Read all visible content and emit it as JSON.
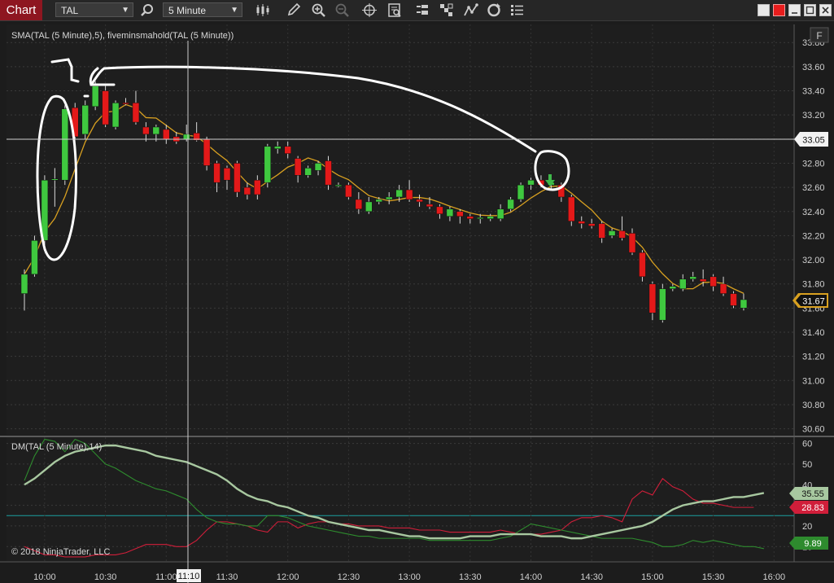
{
  "toolbar": {
    "title": "Chart",
    "instrument": "TAL",
    "interval": "5 Minute"
  },
  "price_panel": {
    "legend": "SMA(TAL (5 Minute),5), fiveminsmahold(TAL (5 Minute))",
    "y_ticks": [
      "33.80",
      "33.60",
      "33.40",
      "33.20",
      "33.00",
      "32.80",
      "32.60",
      "32.40",
      "32.20",
      "32.00",
      "31.80",
      "31.60",
      "31.40",
      "31.20",
      "31.00",
      "30.80",
      "30.60"
    ],
    "crosshair_price": "33.05",
    "last_price": "31.67",
    "f_button": "F"
  },
  "dm_panel": {
    "legend": "DM(TAL (5 Minute),14)",
    "y_ticks": [
      "60",
      "50",
      "40",
      "30",
      "20",
      "10"
    ],
    "adx_value": "35.55",
    "minus_di_value": "28.83",
    "plus_di_value": "9.89",
    "copyright": "© 2018 NinjaTrader, LLC"
  },
  "time_axis": {
    "labels": [
      "10:00",
      "10:30",
      "11:00",
      "11:30",
      "12:00",
      "12:30",
      "13:00",
      "13:30",
      "14:00",
      "14:30",
      "15:00",
      "15:30",
      "16:00"
    ],
    "crosshair_time": "11:10"
  },
  "colors": {
    "up_candle": "#3fc83f",
    "down_candle": "#e31919",
    "sma": "#d8a020",
    "adx": "#a8c8a0",
    "plus_di": "#2e8b2e",
    "minus_di": "#d01e3a",
    "title_bar": "#8e1620"
  },
  "icons": [
    "search-icon",
    "bar-style-icon",
    "pencil-icon",
    "zoom-in-icon",
    "zoom-out-icon",
    "crosshair-icon",
    "properties-icon",
    "data-box-icon",
    "strategy-icon",
    "indicator-icon",
    "refresh-icon",
    "list-icon"
  ],
  "chart_data": {
    "type": "candlestick",
    "candles": [
      {
        "o": 31.72,
        "h": 31.92,
        "l": 31.58,
        "c": 31.88
      },
      {
        "o": 31.88,
        "h": 32.2,
        "l": 31.86,
        "c": 32.16
      },
      {
        "o": 32.16,
        "h": 32.7,
        "l": 32.12,
        "c": 32.66
      },
      {
        "o": 32.66,
        "h": 32.76,
        "l": 32.44,
        "c": 32.67
      },
      {
        "o": 32.66,
        "h": 33.28,
        "l": 32.62,
        "c": 33.25
      },
      {
        "o": 33.26,
        "h": 33.3,
        "l": 33.0,
        "c": 33.02
      },
      {
        "o": 33.04,
        "h": 33.32,
        "l": 33.0,
        "c": 33.28
      },
      {
        "o": 33.27,
        "h": 33.48,
        "l": 33.24,
        "c": 33.44
      },
      {
        "o": 33.4,
        "h": 33.44,
        "l": 33.1,
        "c": 33.12
      },
      {
        "o": 33.1,
        "h": 33.32,
        "l": 33.08,
        "c": 33.3
      },
      {
        "o": 33.3,
        "h": 33.34,
        "l": 33.28,
        "c": 33.29
      },
      {
        "o": 33.3,
        "h": 33.4,
        "l": 33.12,
        "c": 33.14
      },
      {
        "o": 33.1,
        "h": 33.14,
        "l": 32.98,
        "c": 33.04
      },
      {
        "o": 33.04,
        "h": 33.12,
        "l": 32.98,
        "c": 33.1
      },
      {
        "o": 33.08,
        "h": 33.12,
        "l": 32.96,
        "c": 33.0
      },
      {
        "o": 33.02,
        "h": 33.06,
        "l": 32.96,
        "c": 32.98
      },
      {
        "o": 33.0,
        "h": 33.12,
        "l": 32.98,
        "c": 33.04
      },
      {
        "o": 33.05,
        "h": 33.14,
        "l": 32.98,
        "c": 32.99
      },
      {
        "o": 33.0,
        "h": 33.02,
        "l": 32.74,
        "c": 32.78
      },
      {
        "o": 32.8,
        "h": 32.82,
        "l": 32.56,
        "c": 32.64
      },
      {
        "o": 32.76,
        "h": 32.78,
        "l": 32.58,
        "c": 32.66
      },
      {
        "o": 32.8,
        "h": 32.82,
        "l": 32.52,
        "c": 32.56
      },
      {
        "o": 32.6,
        "h": 32.64,
        "l": 32.5,
        "c": 32.54
      },
      {
        "o": 32.66,
        "h": 32.7,
        "l": 32.5,
        "c": 32.54
      },
      {
        "o": 32.64,
        "h": 32.96,
        "l": 32.6,
        "c": 32.94
      },
      {
        "o": 32.92,
        "h": 32.98,
        "l": 32.88,
        "c": 32.94
      },
      {
        "o": 32.94,
        "h": 32.98,
        "l": 32.84,
        "c": 32.88
      },
      {
        "o": 32.84,
        "h": 32.86,
        "l": 32.64,
        "c": 32.7
      },
      {
        "o": 32.7,
        "h": 32.78,
        "l": 32.68,
        "c": 32.76
      },
      {
        "o": 32.74,
        "h": 32.82,
        "l": 32.7,
        "c": 32.8
      },
      {
        "o": 32.82,
        "h": 32.86,
        "l": 32.58,
        "c": 32.62
      },
      {
        "o": 32.62,
        "h": 32.64,
        "l": 32.6,
        "c": 32.62
      },
      {
        "o": 32.62,
        "h": 32.64,
        "l": 32.5,
        "c": 32.52
      },
      {
        "o": 32.5,
        "h": 32.56,
        "l": 32.38,
        "c": 32.42
      },
      {
        "o": 32.4,
        "h": 32.52,
        "l": 32.38,
        "c": 32.48
      },
      {
        "o": 32.48,
        "h": 32.52,
        "l": 32.46,
        "c": 32.5
      },
      {
        "o": 32.5,
        "h": 32.56,
        "l": 32.46,
        "c": 32.52
      },
      {
        "o": 32.52,
        "h": 32.62,
        "l": 32.48,
        "c": 32.58
      },
      {
        "o": 32.58,
        "h": 32.66,
        "l": 32.48,
        "c": 32.5
      },
      {
        "o": 32.5,
        "h": 32.54,
        "l": 32.44,
        "c": 32.48
      },
      {
        "o": 32.46,
        "h": 32.52,
        "l": 32.42,
        "c": 32.44
      },
      {
        "o": 32.44,
        "h": 32.46,
        "l": 32.34,
        "c": 32.38
      },
      {
        "o": 32.36,
        "h": 32.44,
        "l": 32.32,
        "c": 32.42
      },
      {
        "o": 32.4,
        "h": 32.42,
        "l": 32.3,
        "c": 32.36
      },
      {
        "o": 32.36,
        "h": 32.38,
        "l": 32.3,
        "c": 32.34
      },
      {
        "o": 32.34,
        "h": 32.38,
        "l": 32.3,
        "c": 32.35
      },
      {
        "o": 32.34,
        "h": 32.38,
        "l": 32.32,
        "c": 32.36
      },
      {
        "o": 32.34,
        "h": 32.46,
        "l": 32.32,
        "c": 32.42
      },
      {
        "o": 32.42,
        "h": 32.52,
        "l": 32.4,
        "c": 32.5
      },
      {
        "o": 32.5,
        "h": 32.64,
        "l": 32.48,
        "c": 32.62
      },
      {
        "o": 32.62,
        "h": 32.68,
        "l": 32.58,
        "c": 32.66
      },
      {
        "o": 32.66,
        "h": 32.7,
        "l": 32.6,
        "c": 32.62
      },
      {
        "o": 32.62,
        "h": 32.68,
        "l": 32.58,
        "c": 32.64
      },
      {
        "o": 32.62,
        "h": 32.64,
        "l": 32.48,
        "c": 32.52
      },
      {
        "o": 32.52,
        "h": 32.54,
        "l": 32.28,
        "c": 32.32
      },
      {
        "o": 32.32,
        "h": 32.36,
        "l": 32.26,
        "c": 32.3
      },
      {
        "o": 32.3,
        "h": 32.34,
        "l": 32.26,
        "c": 32.28
      },
      {
        "o": 32.3,
        "h": 32.32,
        "l": 32.14,
        "c": 32.18
      },
      {
        "o": 32.2,
        "h": 32.26,
        "l": 32.18,
        "c": 32.24
      },
      {
        "o": 32.24,
        "h": 32.36,
        "l": 32.16,
        "c": 32.18
      },
      {
        "o": 32.22,
        "h": 32.26,
        "l": 32.04,
        "c": 32.06
      },
      {
        "o": 32.06,
        "h": 32.08,
        "l": 31.82,
        "c": 31.86
      },
      {
        "o": 31.8,
        "h": 31.82,
        "l": 31.5,
        "c": 31.56
      },
      {
        "o": 31.5,
        "h": 31.8,
        "l": 31.48,
        "c": 31.76
      },
      {
        "o": 31.76,
        "h": 31.8,
        "l": 31.74,
        "c": 31.78
      },
      {
        "o": 31.76,
        "h": 31.88,
        "l": 31.74,
        "c": 31.84
      },
      {
        "o": 31.84,
        "h": 31.9,
        "l": 31.82,
        "c": 31.86
      },
      {
        "o": 31.84,
        "h": 31.92,
        "l": 31.78,
        "c": 31.82
      },
      {
        "o": 31.86,
        "h": 31.88,
        "l": 31.74,
        "c": 31.78
      },
      {
        "o": 31.8,
        "h": 31.86,
        "l": 31.7,
        "c": 31.72
      },
      {
        "o": 31.72,
        "h": 31.74,
        "l": 31.6,
        "c": 31.62
      },
      {
        "o": 31.6,
        "h": 31.72,
        "l": 31.58,
        "c": 31.67
      }
    ],
    "y_range": [
      30.55,
      33.95
    ],
    "dm_range": [
      3,
      63
    ],
    "dm_reference_level": 25,
    "adx": [
      40,
      43,
      47,
      51,
      54,
      56,
      57,
      58,
      59,
      59,
      58,
      57,
      56,
      54,
      53,
      52,
      51,
      49,
      47,
      45,
      42,
      38,
      35,
      33,
      32,
      30,
      29,
      27,
      25,
      24,
      22,
      21,
      20,
      19,
      18,
      18,
      17,
      16,
      15,
      15,
      14,
      14,
      14,
      14,
      15,
      15,
      15,
      16,
      16,
      16,
      16,
      15,
      15,
      15,
      14,
      14,
      15,
      16,
      17,
      18,
      19,
      20,
      22,
      25,
      28,
      30,
      31,
      32,
      32,
      33,
      34,
      34,
      35,
      36
    ],
    "plus_di": [
      42,
      54,
      62,
      61,
      56,
      62,
      60,
      55,
      50,
      48,
      45,
      42,
      40,
      38,
      37,
      35,
      33,
      28,
      24,
      22,
      21,
      21,
      20,
      20,
      25,
      25,
      24,
      22,
      20,
      19,
      18,
      17,
      16,
      15,
      15,
      14,
      14,
      14,
      14,
      14,
      13,
      13,
      13,
      13,
      13,
      13,
      13,
      14,
      15,
      18,
      21,
      20,
      19,
      18,
      17,
      16,
      15,
      14,
      14,
      14,
      14,
      13,
      12,
      10,
      10,
      11,
      13,
      12,
      13,
      12,
      11,
      10,
      10,
      9
    ],
    "minus_di": [
      10,
      8,
      6,
      6,
      5,
      5,
      5,
      6,
      6,
      6,
      7,
      9,
      11,
      11,
      11,
      10,
      10,
      13,
      18,
      22,
      22,
      21,
      20,
      18,
      17,
      22,
      22,
      19,
      21,
      22,
      22,
      21,
      21,
      20,
      20,
      20,
      19,
      19,
      19,
      18,
      18,
      18,
      17,
      17,
      17,
      17,
      17,
      18,
      17,
      16,
      16,
      16,
      17,
      18,
      22,
      24,
      24,
      25,
      24,
      22,
      33,
      37,
      35,
      43,
      39,
      37,
      33,
      31,
      31,
      30,
      29,
      29,
      29
    ]
  }
}
